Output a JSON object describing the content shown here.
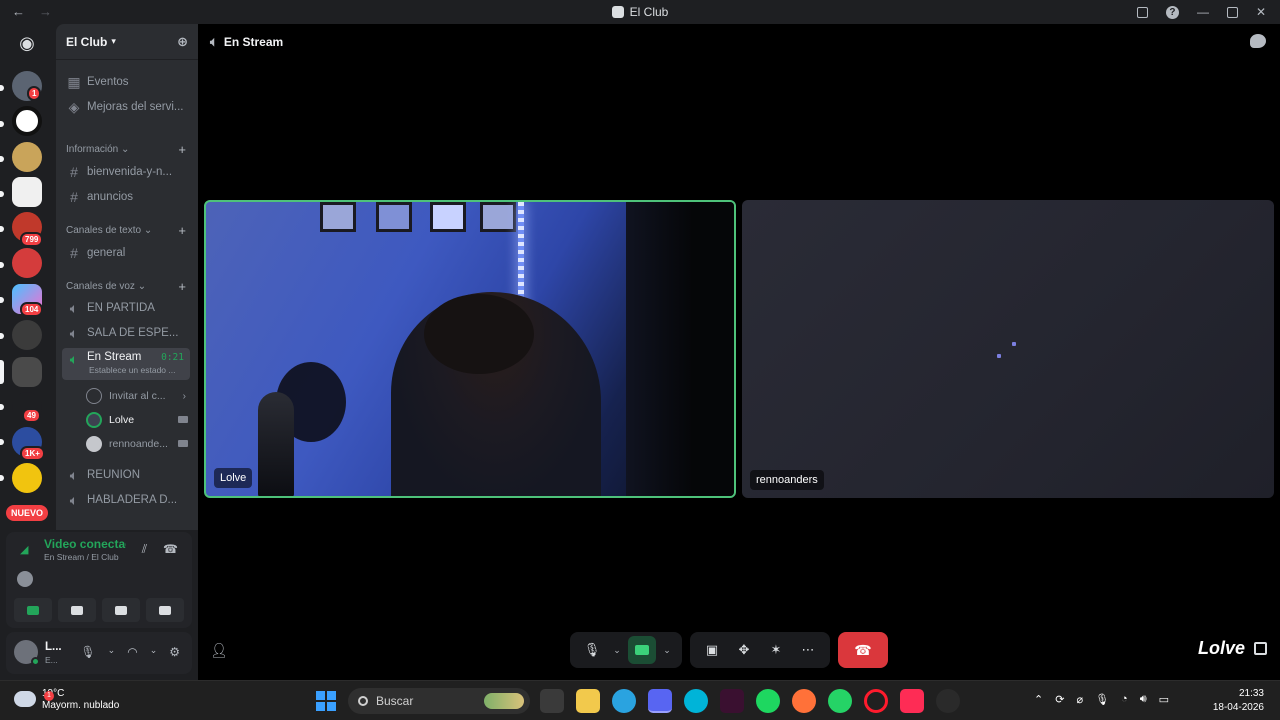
{
  "window": {
    "title": "El Club"
  },
  "guild": {
    "name": "El Club"
  },
  "server_badges": {
    "s1": "1",
    "s5": "799",
    "s7": "104",
    "s10": "49",
    "s11": "1K+",
    "nuevo": "NUEVO"
  },
  "channels": {
    "eventos": "Eventos",
    "mejoras": "Mejoras del servi...",
    "cat_info": "Información",
    "bienvenida": "bienvenida-y-n...",
    "anuncios": "anuncios",
    "cat_texto": "Canales de texto",
    "general": "general",
    "cat_voz": "Canales de voz",
    "en_partida": "EN PARTIDA",
    "sala_espera": "SALA DE ESPE...",
    "en_stream": "En Stream",
    "en_stream_time": "0:21",
    "en_stream_status": "Establece un estado ...",
    "invitar": "Invitar al c...",
    "user1": "Lolve",
    "user2": "rennoande...",
    "reunion": "REUNION",
    "habladera": "HABLADERA D..."
  },
  "voice_panel": {
    "status": "Video conectado",
    "location": "En Stream / El Club"
  },
  "userbar": {
    "name": "L...",
    "status": "E..."
  },
  "stage": {
    "channel": "En Stream",
    "tile1_name": "Lolve",
    "tile2_name": "rennoanders",
    "watermark": "Lolve"
  },
  "taskbar": {
    "temp": "19°C",
    "condition": "Mayorm. nublado",
    "weather_badge": "1",
    "search_placeholder": "Buscar",
    "time": "21:33",
    "date": "18-04-2026"
  }
}
